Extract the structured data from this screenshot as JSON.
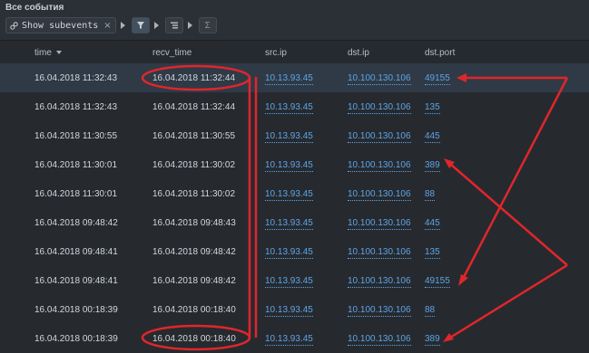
{
  "title": "Все события",
  "toolbar": {
    "chip_label": "Show subevents",
    "chip_close": "×",
    "sigma": "Σ"
  },
  "columns": {
    "time": "time",
    "recv_time": "recv_time",
    "src_ip": "src.ip",
    "dst_ip": "dst.ip",
    "dst_port": "dst.port"
  },
  "rows": [
    {
      "time": "16.04.2018 11:32:43",
      "recv_time": "16.04.2018 11:32:44",
      "src_ip": "10.13.93.45",
      "dst_ip": "10.100.130.106",
      "dst_port": "49155"
    },
    {
      "time": "16.04.2018 11:32:43",
      "recv_time": "16.04.2018 11:32:44",
      "src_ip": "10.13.93.45",
      "dst_ip": "10.100.130.106",
      "dst_port": "135"
    },
    {
      "time": "16.04.2018 11:30:55",
      "recv_time": "16.04.2018 11:30:55",
      "src_ip": "10.13.93.45",
      "dst_ip": "10.100.130.106",
      "dst_port": "445"
    },
    {
      "time": "16.04.2018 11:30:01",
      "recv_time": "16.04.2018 11:30:02",
      "src_ip": "10.13.93.45",
      "dst_ip": "10.100.130.106",
      "dst_port": "389"
    },
    {
      "time": "16.04.2018 11:30:01",
      "recv_time": "16.04.2018 11:30:02",
      "src_ip": "10.13.93.45",
      "dst_ip": "10.100.130.106",
      "dst_port": "88"
    },
    {
      "time": "16.04.2018 09:48:42",
      "recv_time": "16.04.2018 09:48:43",
      "src_ip": "10.13.93.45",
      "dst_ip": "10.100.130.106",
      "dst_port": "445"
    },
    {
      "time": "16.04.2018 09:48:41",
      "recv_time": "16.04.2018 09:48:42",
      "src_ip": "10.13.93.45",
      "dst_ip": "10.100.130.106",
      "dst_port": "135"
    },
    {
      "time": "16.04.2018 09:48:41",
      "recv_time": "16.04.2018 09:48:42",
      "src_ip": "10.13.93.45",
      "dst_ip": "10.100.130.106",
      "dst_port": "49155"
    },
    {
      "time": "16.04.2018 00:18:39",
      "recv_time": "16.04.2018 00:18:40",
      "src_ip": "10.13.93.45",
      "dst_ip": "10.100.130.106",
      "dst_port": "88"
    },
    {
      "time": "16.04.2018 00:18:39",
      "recv_time": "16.04.2018 00:18:40",
      "src_ip": "10.13.93.45",
      "dst_ip": "10.100.130.106",
      "dst_port": "389"
    }
  ],
  "colors": {
    "background": "#262a2f",
    "selected_row": "#2f3a46",
    "link": "#5ea4e6",
    "annotation": "#e0262b"
  },
  "icons": [
    "link-icon",
    "close-icon",
    "filter-icon",
    "group-icon",
    "sigma-icon",
    "sort-down-icon"
  ]
}
